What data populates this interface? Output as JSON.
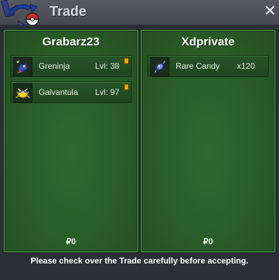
{
  "window": {
    "title": "Trade",
    "close_label": "✕"
  },
  "left_panel": {
    "player": "Grabarz23",
    "items": [
      {
        "name": "Greninja",
        "level": "Lvl: 38",
        "icon": "greninja-icon"
      },
      {
        "name": "Galvantula",
        "level": "Lvl: 97",
        "icon": "galvantula-icon"
      }
    ],
    "money": "₽0"
  },
  "right_panel": {
    "player": "Xdprivate",
    "items": [
      {
        "name": "Rare Candy",
        "quantity": "x120",
        "icon": "rare-candy-icon"
      }
    ],
    "money": "₽0"
  },
  "footer": {
    "message": "Please check over the Trade carefully before accepting."
  },
  "colors": {
    "panel_green": "#2b5f29",
    "panel_border": "#3d7a36",
    "window_bg": "#2c2f37",
    "tag_orange": "#f2a400"
  }
}
